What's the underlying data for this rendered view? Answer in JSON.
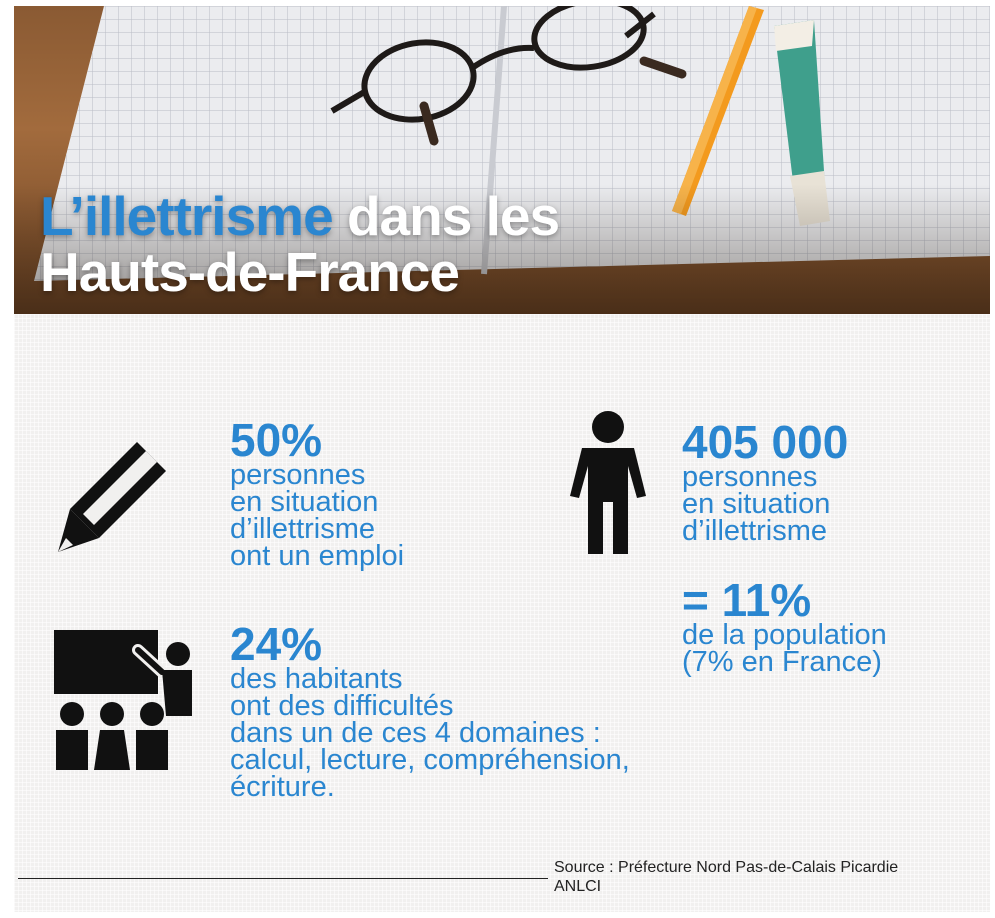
{
  "title": {
    "part1": "L’illettrisme",
    "part2": "dans les",
    "line2": "Hauts-de-France"
  },
  "stats": {
    "employ": {
      "value": "50%",
      "lines": [
        "personnes",
        "en situation",
        "d’illettrisme",
        "ont un emploi"
      ]
    },
    "people": {
      "value": "405 000",
      "lines": [
        "personnes",
        "en situation",
        "d’illettrisme"
      ]
    },
    "share": {
      "value": "= 11%",
      "lines": [
        "de la population",
        "(7% en France)"
      ]
    },
    "difficulties": {
      "value": "24%",
      "lines": [
        "des habitants",
        "ont des difficultés",
        "dans un de ces 4 domaines :",
        "calcul, lecture, compréhension,",
        "écriture."
      ]
    }
  },
  "source": {
    "line1": "Source : Préfecture Nord Pas-de-Calais Picardie",
    "line2": "ANLCI"
  },
  "icons": [
    "pencil-icon",
    "person-icon",
    "teacher-classroom-icon"
  ],
  "colors": {
    "accent": "#2a86d0",
    "text_dark": "#111111"
  }
}
